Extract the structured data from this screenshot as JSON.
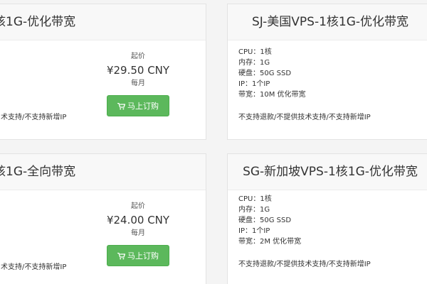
{
  "plans": [
    {
      "title": "核1G-优化带宽",
      "price_caption": "起价",
      "price": "¥29.50 CNY",
      "cycle": "每月",
      "order_label": "马上订购",
      "note": "术支持/不支持新增IP"
    },
    {
      "title": "SJ-美国VPS-1核1G-优化带宽",
      "specs": [
        "CPU：1核",
        "内存：1G",
        "硬盘：50G SSD",
        "IP：1个IP",
        "带宽：10M 优化带宽"
      ],
      "note": "不支持退款/不提供技术支持/不支持新增IP"
    },
    {
      "title": "核1G-全向带宽",
      "price_caption": "起价",
      "price": "¥24.00 CNY",
      "cycle": "每月",
      "order_label": "马上订购",
      "note": "术支持/不支持新增IP"
    },
    {
      "title": "SG-新加坡VPS-1核1G-优化带宽",
      "specs": [
        "CPU：1核",
        "内存：1G",
        "硬盘：50G SSD",
        "IP：1个IP",
        "带宽：2M 优化带宽"
      ],
      "note": "不支持退款/不提供技术支持/不支持新增IP"
    }
  ],
  "colors": {
    "order_button": "#5cb85c",
    "card_border": "#e3e3e3",
    "page_background": "#f4f4f4"
  }
}
